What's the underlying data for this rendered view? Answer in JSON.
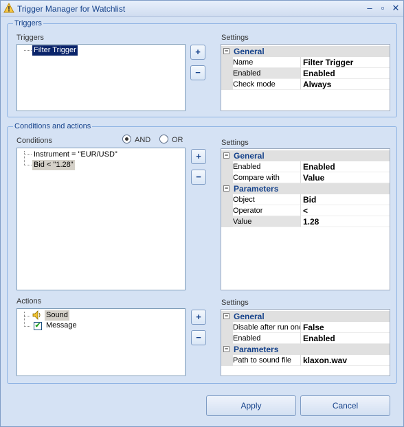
{
  "window": {
    "title": "Trigger Manager for Watchlist",
    "minimize_glyph": "–",
    "maximize_glyph": "▫",
    "close_glyph": "✕"
  },
  "triggers_group": {
    "legend": "Triggers",
    "list_label": "Triggers",
    "items": [
      "Filter Trigger"
    ],
    "add_glyph": "+",
    "remove_glyph": "−",
    "settings_label": "Settings",
    "settings": {
      "category": "General",
      "rows": [
        {
          "name": "Name",
          "value": "Filter Trigger"
        },
        {
          "name": "Enabled",
          "value": "Enabled"
        },
        {
          "name": "Check mode",
          "value": "Always"
        }
      ]
    }
  },
  "conditions_group": {
    "legend": "Conditions and actions",
    "conditions_label": "Conditions",
    "and_label": "AND",
    "or_label": "OR",
    "logic_selected": "AND",
    "conditions": [
      "Instrument = \"EUR/USD\"",
      "Bid < \"1.28\""
    ],
    "add_glyph": "+",
    "remove_glyph": "−",
    "settings_label": "Settings",
    "settings": {
      "general": {
        "category": "General",
        "rows": [
          {
            "name": "Enabled",
            "value": "Enabled"
          },
          {
            "name": "Compare with",
            "value": "Value"
          }
        ]
      },
      "parameters": {
        "category": "Parameters",
        "rows": [
          {
            "name": "Object",
            "value": "Bid"
          },
          {
            "name": "Operator",
            "value": "<"
          },
          {
            "name": "Value",
            "value": "1.28"
          }
        ]
      }
    },
    "actions_label": "Actions",
    "actions": [
      {
        "label": "Sound",
        "icon": "speaker-icon"
      },
      {
        "label": "Message",
        "icon": "checkbox-message-icon"
      }
    ],
    "actions_add_glyph": "+",
    "actions_remove_glyph": "−",
    "actions_settings_label": "Settings",
    "actions_settings": {
      "general": {
        "category": "General",
        "rows": [
          {
            "name": "Disable after run onc",
            "value": "False"
          },
          {
            "name": "Enabled",
            "value": "Enabled"
          }
        ]
      },
      "parameters": {
        "category": "Parameters",
        "rows": [
          {
            "name": "Path to sound file",
            "value": "klaxon.wav"
          }
        ]
      }
    }
  },
  "footer": {
    "apply_label": "Apply",
    "cancel_label": "Cancel"
  },
  "colors": {
    "accent": "#15428b",
    "background": "#d5e2f4",
    "selection": "#0a246a",
    "border": "#8db2e3"
  }
}
